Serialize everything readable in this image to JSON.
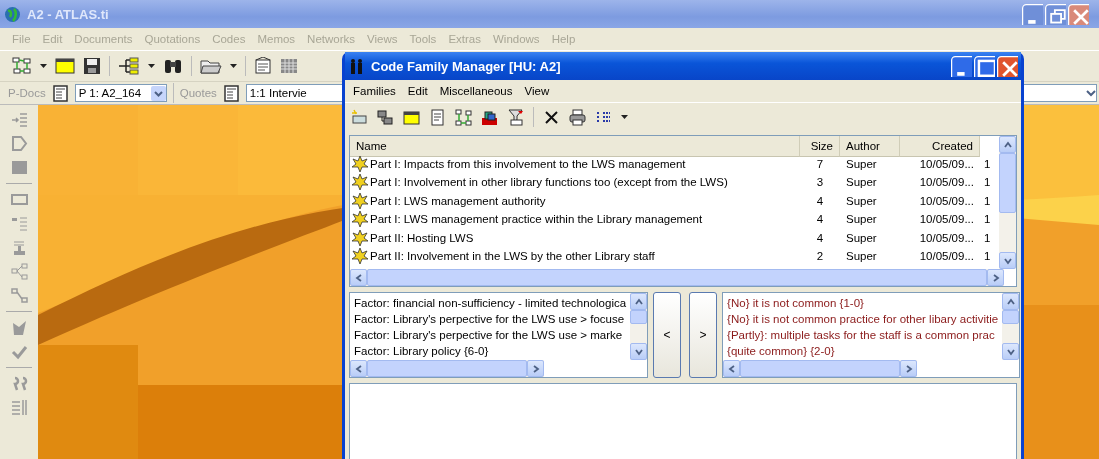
{
  "main_window": {
    "title": "A2 - ATLAS.ti",
    "menu": [
      "File",
      "Edit",
      "Documents",
      "Quotations",
      "Codes",
      "Memos",
      "Networks",
      "Views",
      "Tools",
      "Extras",
      "Windows",
      "Help"
    ],
    "doc_bar": {
      "pdocs_label": "P-Docs",
      "pdoc_value": "P 1: A2_164",
      "quotes_label": "Quotes",
      "quote_value": "1:1 Intervie"
    }
  },
  "dialog": {
    "title": "Code Family Manager [HU: A2]",
    "menu": [
      "Families",
      "Edit",
      "Miscellaneous",
      "View"
    ],
    "columns": [
      "Name",
      "Size",
      "Author",
      "Created"
    ],
    "rows": [
      {
        "name": "Part I: Impacts from this involvement to the LWS management",
        "size": "7",
        "author": "Super",
        "created": "10/05/09...",
        "column_5": "1"
      },
      {
        "name": "Part I: Involvement in other library functions too (except from the LWS)",
        "size": "3",
        "author": "Super",
        "created": "10/05/09...",
        "column_5": "1"
      },
      {
        "name": "Part I: LWS management authority",
        "size": "4",
        "author": "Super",
        "created": "10/05/09...",
        "column_5": "1"
      },
      {
        "name": "Part I: LWS management practice within the Library management",
        "size": "4",
        "author": "Super",
        "created": "10/05/09...",
        "column_5": "1"
      },
      {
        "name": "Part II: Hosting LWS",
        "size": "4",
        "author": "Super",
        "created": "10/05/09...",
        "column_5": "1"
      },
      {
        "name": "Part II: Involvement in the LWS by the other Library staff",
        "size": "2",
        "author": "Super",
        "created": "10/05/09...",
        "column_5": "1"
      }
    ],
    "left_list": [
      "Factor: financial non-sufficiency - limited technologica",
      "Factor: Library's perpective for the LWS use > focuse",
      "Factor: Library's perpective for the LWS use > marke",
      "Factor: Library policy {6-0}"
    ],
    "move_buttons": [
      "<",
      ">"
    ],
    "right_list": [
      "{No} it is not common {1-0}",
      "{No} it is not common practice for other libary activitie",
      "{Partly}: multiple tasks for the staff is a common prac",
      "{quite common} {2-0}"
    ]
  }
}
